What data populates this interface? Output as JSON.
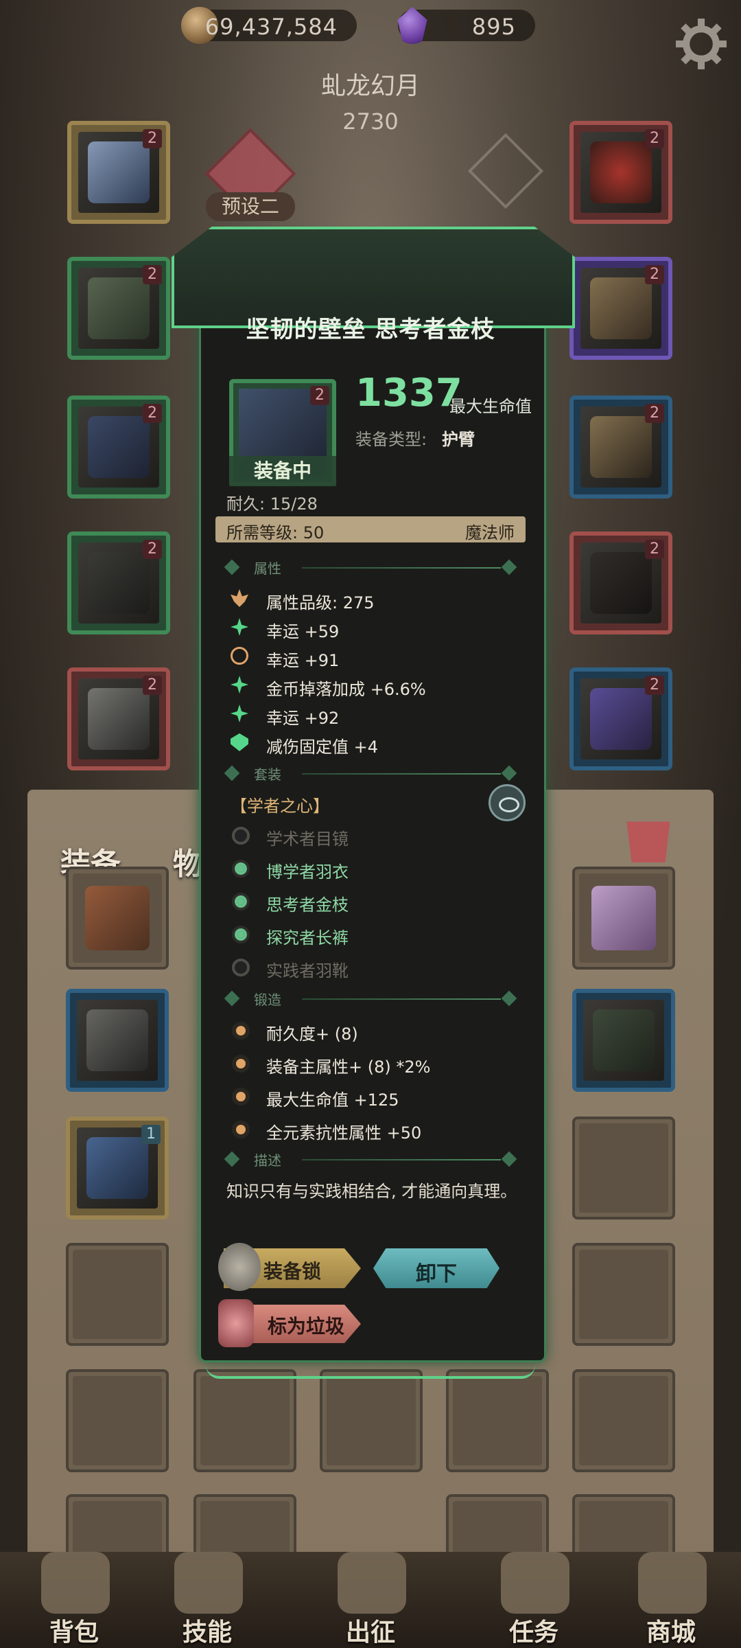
{
  "currencies": {
    "gold": {
      "icon": "coin-icon",
      "value": "69,437,584"
    },
    "gems": {
      "icon": "gem-icon",
      "value": "895"
    }
  },
  "character": {
    "name": "虬龙幻月",
    "power": "2730"
  },
  "preset": {
    "label": "预设二"
  },
  "tabs": {
    "equipment": "装备",
    "items": "物"
  },
  "slots": {
    "badge": "2",
    "badge_one": "1"
  },
  "item_detail": {
    "title": "坚韧的壁垒 思考者金枝",
    "equipped_tag": "装备中",
    "main_stat_value": "1337",
    "main_stat_label": "最大生命值",
    "equip_type_label": "装备类型:",
    "equip_type_value": "护臂",
    "durability": "耐久: 15/28",
    "required_level": "所需等级: 50",
    "required_class": "魔法师",
    "attributes_header": "属性",
    "attributes": [
      {
        "icon": "lotus-icon",
        "text": "属性品级: 275"
      },
      {
        "icon": "star-icon",
        "text": "幸运 +59"
      },
      {
        "icon": "cycle-icon",
        "text": "幸运 +91"
      },
      {
        "icon": "star-icon",
        "text": "金币掉落加成 +6.6%"
      },
      {
        "icon": "star-icon",
        "text": "幸运 +92"
      },
      {
        "icon": "arrow-icon",
        "text": "减伤固定值 +4"
      }
    ],
    "set_header": "套装",
    "set_name": "【学者之心】",
    "set_items": [
      {
        "text": "学术者目镜",
        "active": false
      },
      {
        "text": "博学者羽衣",
        "active": true
      },
      {
        "text": "思考者金枝",
        "active": true
      },
      {
        "text": "探究者长裤",
        "active": true
      },
      {
        "text": "实践者羽靴",
        "active": false
      }
    ],
    "forge_header": "锻造",
    "forge": [
      {
        "text": "耐久度+ (8)"
      },
      {
        "text": "装备主属性+ (8) *2%"
      },
      {
        "text": "最大生命值 +125"
      },
      {
        "text": "全元素抗性属性 +50"
      }
    ],
    "desc_header": "描述",
    "description": "知识只有与实践相结合, 才能通向真理。",
    "buttons": {
      "lock": "装备锁",
      "unequip": "卸下",
      "junk": "标为垃圾"
    }
  },
  "nav": [
    {
      "label": "背包",
      "icon": "backpack-icon"
    },
    {
      "label": "技能",
      "icon": "skills-icon"
    },
    {
      "label": "出征",
      "icon": "battle-icon"
    },
    {
      "label": "任务",
      "icon": "quest-icon"
    },
    {
      "label": "商城",
      "icon": "shop-icon"
    }
  ]
}
